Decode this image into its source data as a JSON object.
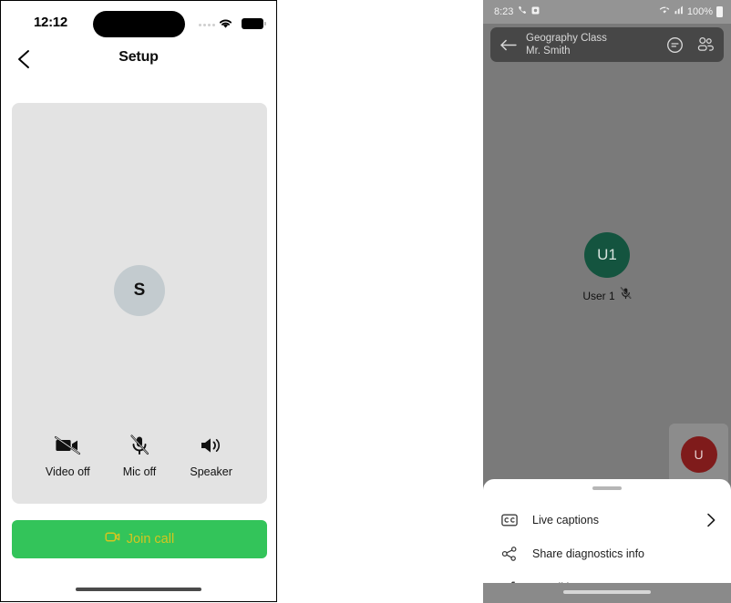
{
  "left_phone": {
    "status_bar": {
      "time": "12:12",
      "signal_icon": "signal-dots-icon",
      "wifi_icon": "wifi-icon",
      "battery_icon": "battery-full-icon"
    },
    "nav": {
      "back_icon": "chevron-left-icon",
      "title": "Setup"
    },
    "preview": {
      "avatar_initial": "S",
      "controls": [
        {
          "icon": "video-off-icon",
          "label": "Video off"
        },
        {
          "icon": "mic-off-icon",
          "label": "Mic off"
        },
        {
          "icon": "speaker-icon",
          "label": "Speaker"
        }
      ]
    },
    "join_button": {
      "label": "Join call",
      "icon": "video-camera-icon",
      "background_color": "#33c45a",
      "text_color": "#d5c51f"
    },
    "home_indicator": "home-indicator"
  },
  "right_phone": {
    "status_bar": {
      "time": "8:23",
      "phone_icon": "phone-icon",
      "camera_icon": "camera-icon",
      "wifi_icon": "wifi-icon",
      "signal_icon": "cell-signal-icon",
      "battery_percent": "100%",
      "battery_icon": "battery-full-icon"
    },
    "header": {
      "back_icon": "arrow-left-icon",
      "title": "Geography Class",
      "subtitle": "Mr. Smith",
      "chat_icon": "chat-bubble-icon",
      "people_icon": "people-icon"
    },
    "participant": {
      "avatar_initials": "U1",
      "avatar_color": "#14543f",
      "name": "User 1",
      "mic_icon": "mic-muted-icon"
    },
    "self_view": {
      "avatar_initial": "U",
      "avatar_color": "#7f1b1b"
    },
    "sheet": {
      "handle": "drag-handle",
      "items": [
        {
          "icon": "closed-captions-icon",
          "label": "Live captions",
          "chevron": "chevron-right-icon"
        },
        {
          "icon": "share-icon",
          "label": "Share diagnostics info",
          "chevron": ""
        },
        {
          "icon": "bicycle-icon",
          "label": "Go Biking",
          "chevron": ""
        }
      ]
    },
    "nav_bar": "home-indicator"
  }
}
